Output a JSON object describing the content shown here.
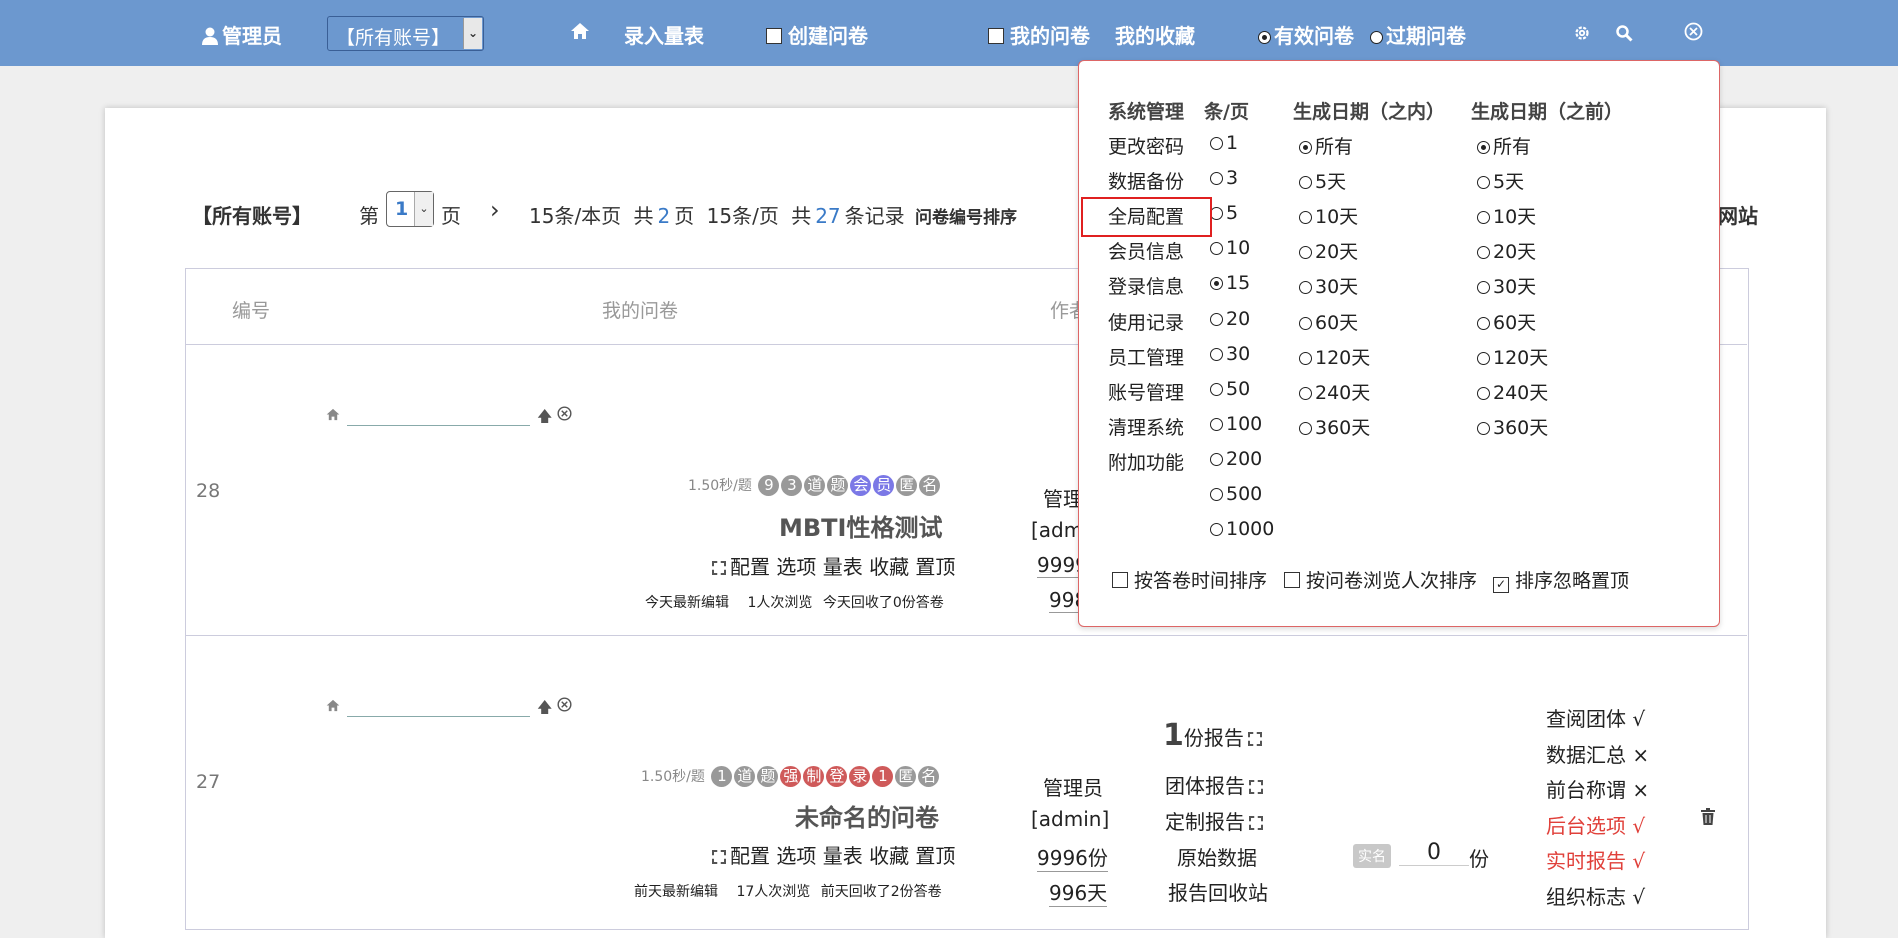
{
  "topbar": {
    "admin_label": "管理员",
    "account_select": "【所有账号】",
    "enter_scale": "录入量表",
    "create_survey": "创建问卷",
    "my_surveys": "我的问卷",
    "my_favorites": "我的收藏",
    "valid_surveys": "有效问卷",
    "expired_surveys": "过期问卷"
  },
  "pager": {
    "account": "【所有账号】",
    "page_prefix": "第",
    "page_value": "1",
    "page_suffix": "页",
    "next": "›",
    "per_page": "15条/本页",
    "total_pages_prefix": "共",
    "total_pages": "2",
    "total_pages_suffix": "页",
    "per_page2": "15条/页",
    "total_records_prefix": "共",
    "total_records": "27",
    "total_records_suffix": "条记录",
    "sort_label": "问卷编号排序",
    "trailing": "网站"
  },
  "table": {
    "headers": {
      "id": "编号",
      "survey": "我的问卷",
      "author": "作者"
    },
    "rows": [
      {
        "id": "28",
        "speed": "1.50秒/题",
        "tags": [
          "9",
          "3",
          "道",
          "题",
          "会",
          "员",
          "匿",
          "名"
        ],
        "title": "MBTI性格测试",
        "actions": "配置 选项 量表 收藏 置顶",
        "meta1": "今天最新编辑",
        "meta2": "1人次浏览",
        "meta3": "今天回收了0份答卷",
        "author_name": "管理",
        "author_acct": "[adm",
        "quota": "9999",
        "days": "998"
      },
      {
        "id": "27",
        "speed": "1.50秒/题",
        "tags": [
          "1",
          "道",
          "题",
          "强",
          "制",
          "登",
          "录",
          "1",
          "匿",
          "名"
        ],
        "title": "未命名的问卷",
        "actions": "配置 选项 量表 收藏 置顶",
        "meta1": "前天最新编辑",
        "meta2": "17人次浏览",
        "meta3": "前天回收了2份答卷",
        "author_name": "管理员",
        "author_acct": "[admin]",
        "quota": "9996份",
        "days": "996天",
        "report_count": "1",
        "report_suffix": "份报告",
        "group_report": "团体报告",
        "custom_report": "定制报告",
        "raw_data": "原始数据",
        "report_bin": "报告回收站",
        "realname_badge": "实名",
        "realname_count": "0",
        "realname_unit": "份",
        "perms": [
          {
            "label": "查阅团体 √",
            "color": "#222222"
          },
          {
            "label": "数据汇总 ×",
            "color": "#222222"
          },
          {
            "label": "前台称谓 ×",
            "color": "#222222"
          },
          {
            "label": "后台选项 √",
            "color": "#e0403a"
          },
          {
            "label": "实时报告 √",
            "color": "#e0403a"
          },
          {
            "label": "组织标志 √",
            "color": "#222222"
          }
        ]
      }
    ]
  },
  "panel": {
    "col_sys": "系统管理",
    "col_per": "条/页",
    "col_within": "生成日期（之内）",
    "col_before": "生成日期（之前）",
    "sys_items": [
      "更改密码",
      "数据备份",
      "全局配置",
      "会员信息",
      "登录信息",
      "使用记录",
      "员工管理",
      "账号管理",
      "清理系统",
      "附加功能"
    ],
    "per_page_options": [
      "1",
      "3",
      "5",
      "10",
      "15",
      "20",
      "30",
      "50",
      "100",
      "200",
      "500",
      "1000"
    ],
    "per_page_selected": "15",
    "within_options": [
      "所有",
      "5天",
      "10天",
      "20天",
      "30天",
      "60天",
      "120天",
      "240天",
      "360天"
    ],
    "before_options": [
      "所有",
      "5天",
      "10天",
      "20天",
      "30天",
      "60天",
      "120天",
      "240天",
      "360天"
    ],
    "sort_time": "按答卷时间排序",
    "sort_views": "按问卷浏览人次排序",
    "ignore_top": "排序忽略置顶"
  }
}
